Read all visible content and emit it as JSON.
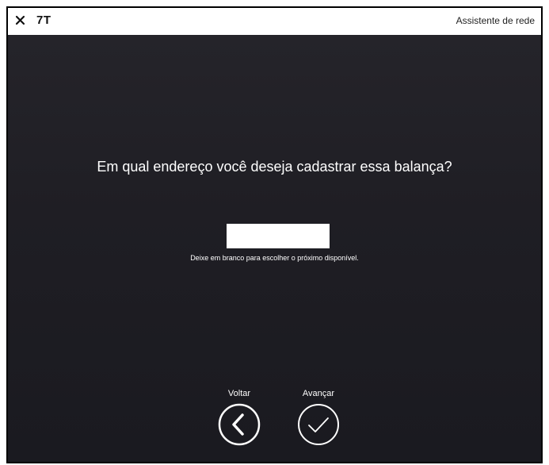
{
  "window": {
    "logo_text": "7T",
    "title": "Assistente de rede",
    "close_icon": "close-icon"
  },
  "main": {
    "question": "Em qual endereço você deseja cadastrar essa balança?",
    "address_value": "",
    "hint": "Deixe em branco para escolher o próximo disponível."
  },
  "nav": {
    "back_label": "Voltar",
    "back_icon": "chevron-left-icon",
    "next_label": "Avançar",
    "next_icon": "checkmark-icon"
  },
  "colors": {
    "background": "#1f1e24",
    "titlebar": "#ffffff",
    "text": "#ffffff"
  }
}
